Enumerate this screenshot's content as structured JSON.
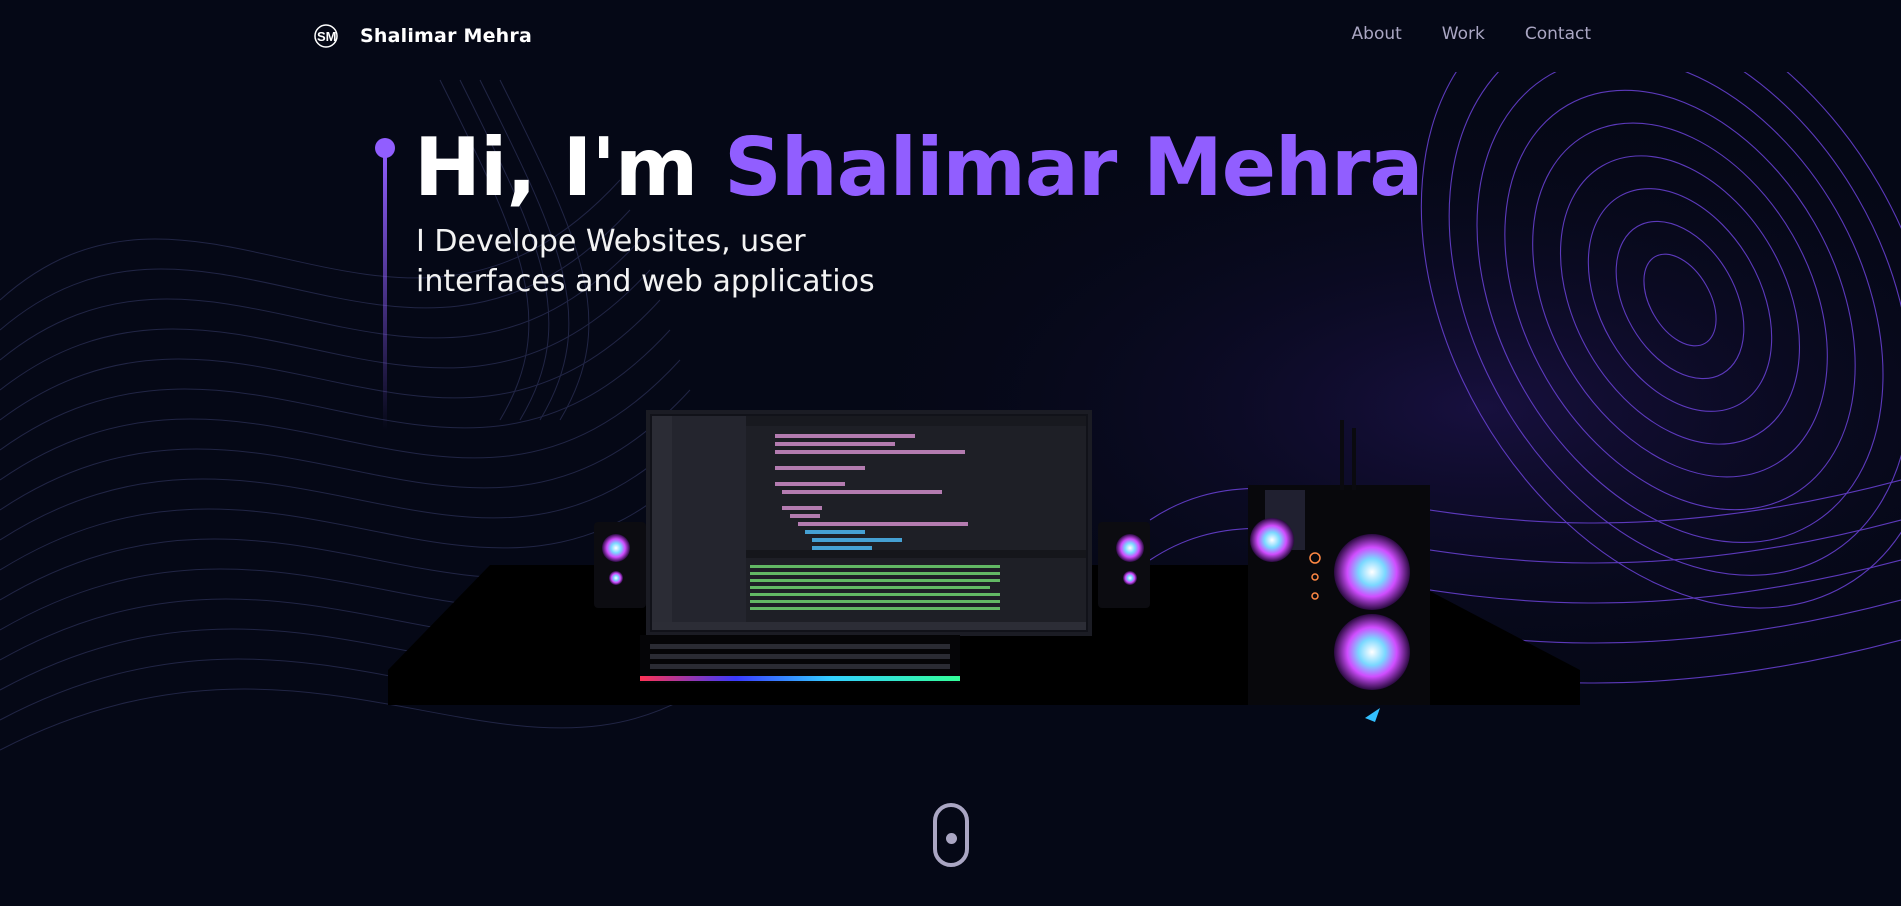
{
  "header": {
    "logo_text": "SM",
    "brand_name": "Shalimar Mehra",
    "nav": [
      {
        "label": "About"
      },
      {
        "label": "Work"
      },
      {
        "label": "Contact"
      }
    ]
  },
  "hero": {
    "greeting": "Hi, I'm ",
    "name": "Shalimar Mehra",
    "tagline": "I Develope Websites, user interfaces and web applicatios"
  },
  "colors": {
    "background": "#050816",
    "accent": "#915eff",
    "nav_text": "#aaa6c3"
  },
  "icons": {
    "scroll": "mouse-scroll-icon"
  }
}
